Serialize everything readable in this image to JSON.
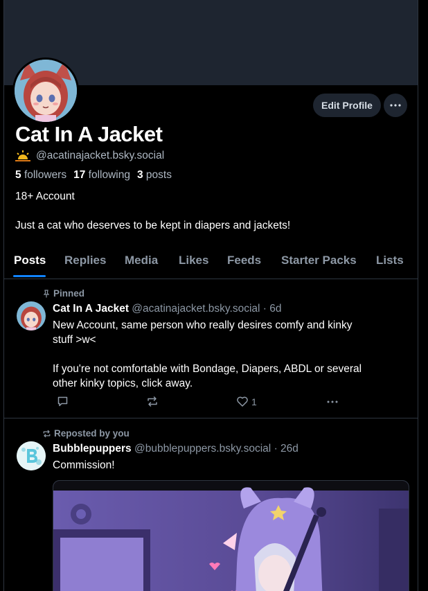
{
  "profile": {
    "display_name": "Cat In A Jacket",
    "handle": "@acatinajacket.bsky.social",
    "followers_count": "5",
    "followers_label": "followers",
    "following_count": "17",
    "following_label": "following",
    "posts_count": "3",
    "posts_label": "posts",
    "age_label": "18+ Account",
    "bio": "Just a cat who deserves to be kept in diapers and jackets!",
    "edit_button": "Edit Profile"
  },
  "tabs": [
    "Posts",
    "Replies",
    "Media",
    "Likes",
    "Feeds",
    "Starter Packs",
    "Lists"
  ],
  "active_tab": "Posts",
  "posts": [
    {
      "context": "Pinned",
      "author": "Cat In A Jacket",
      "handle": "@acatinajacket.bsky.social",
      "time": "· 6d",
      "lines": [
        "New Account, same person who really desires comfy and kinky",
        "stuff >w<",
        "",
        "If you're not comfortable with Bondage, Diapers, ABDL or several",
        "other kinky topics, click away."
      ],
      "like_count": "1"
    },
    {
      "context": "Reposted by you",
      "author": "Bubblepuppers",
      "handle": "@bubblepuppers.bsky.social",
      "time": "· 26d",
      "text": "Commission!"
    }
  ],
  "colors": {
    "accent": "#1083fe",
    "banner": "#1e2530",
    "muted": "#8d98a5",
    "border": "#2e3640"
  },
  "icons": [
    "ellipsis-icon",
    "sun-emoji-icon",
    "pin-icon",
    "repost-icon",
    "reply-icon",
    "like-icon",
    "more-icon"
  ]
}
